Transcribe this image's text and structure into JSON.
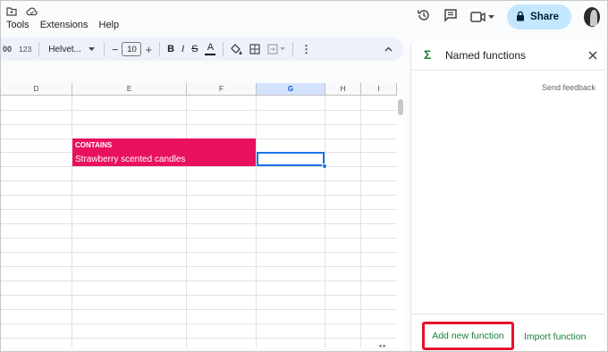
{
  "menu": {
    "items": [
      "Tools",
      "Extensions",
      "Help"
    ]
  },
  "top": {
    "share_label": "Share"
  },
  "toolbar": {
    "decimals_label": "00",
    "number_format_label": "123",
    "font_family": "Helvet...",
    "font_size": "10",
    "minus_label": "−",
    "plus_label": "+",
    "bold_label": "B",
    "italic_label": "I",
    "strike_label": "S",
    "text_color_label": "A",
    "more_label": "⋮",
    "collapse_label": "^"
  },
  "grid": {
    "columns": [
      "D",
      "E",
      "F",
      "G",
      "H",
      "I"
    ],
    "active_column": "G",
    "cells": {
      "e_label": "CONTAINS",
      "e_value": "Strawberry scented candles"
    }
  },
  "panel": {
    "title": "Named functions",
    "send_feedback": "Send feedback",
    "add_button": "Add new function",
    "import_button": "Import function"
  },
  "colors": {
    "pink_fill": "#e8115f",
    "accent_green": "#188038",
    "selection_blue": "#1a73e8",
    "highlight_red": "#e8112d"
  },
  "icons": [
    "folder-icon",
    "cloud-icon",
    "history-icon",
    "comment-icon",
    "video-icon",
    "lock-icon",
    "sigma-icon",
    "close-icon",
    "paint-bucket-icon",
    "borders-icon",
    "merge-icon",
    "drag-handle-icon"
  ]
}
